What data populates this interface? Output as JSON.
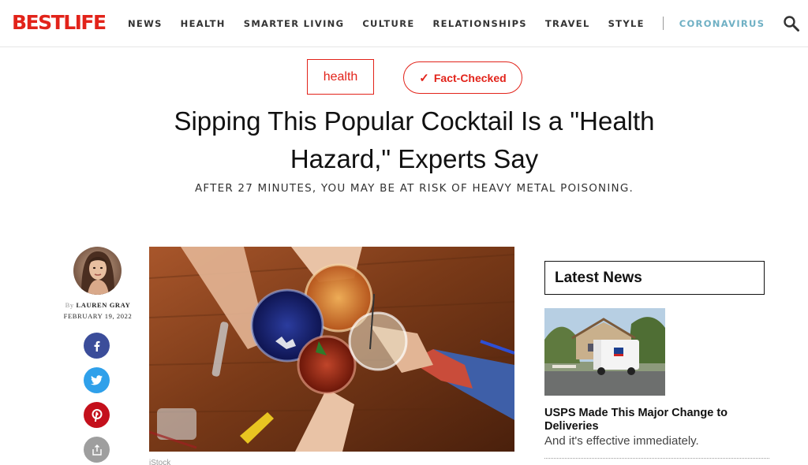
{
  "brand": {
    "name": "BESTLIFE",
    "color": "#e2231a"
  },
  "nav": {
    "items": [
      {
        "label": "NEWS"
      },
      {
        "label": "HEALTH"
      },
      {
        "label": "SMARTER LIVING"
      },
      {
        "label": "CULTURE"
      },
      {
        "label": "RELATIONSHIPS"
      },
      {
        "label": "TRAVEL"
      },
      {
        "label": "STYLE"
      }
    ],
    "highlight": {
      "label": "CORONAVIRUS",
      "color": "#6fb0c4"
    },
    "search_icon": "search-icon"
  },
  "article": {
    "category": "health",
    "fact_check": {
      "icon": "check-icon",
      "label": "Fact-Checked"
    },
    "headline": "Sipping This Popular Cocktail Is a \"Health Hazard,\" Experts Say",
    "dek": "AFTER 27 MINUTES, YOU MAY BE AT RISK OF HEAVY METAL POISONING.",
    "byline_prefix": "By",
    "author": "LAUREN GRAY",
    "date": "FEBRUARY 19, 2022",
    "share_icons": [
      "facebook-icon",
      "twitter-icon",
      "pinterest-icon",
      "share-icon"
    ],
    "image_credit": "iStock"
  },
  "sidebar": {
    "heading": "Latest News",
    "story": {
      "title": "USPS Made This Major Change to Deliveries",
      "dek": "And it's effective immediately."
    }
  }
}
